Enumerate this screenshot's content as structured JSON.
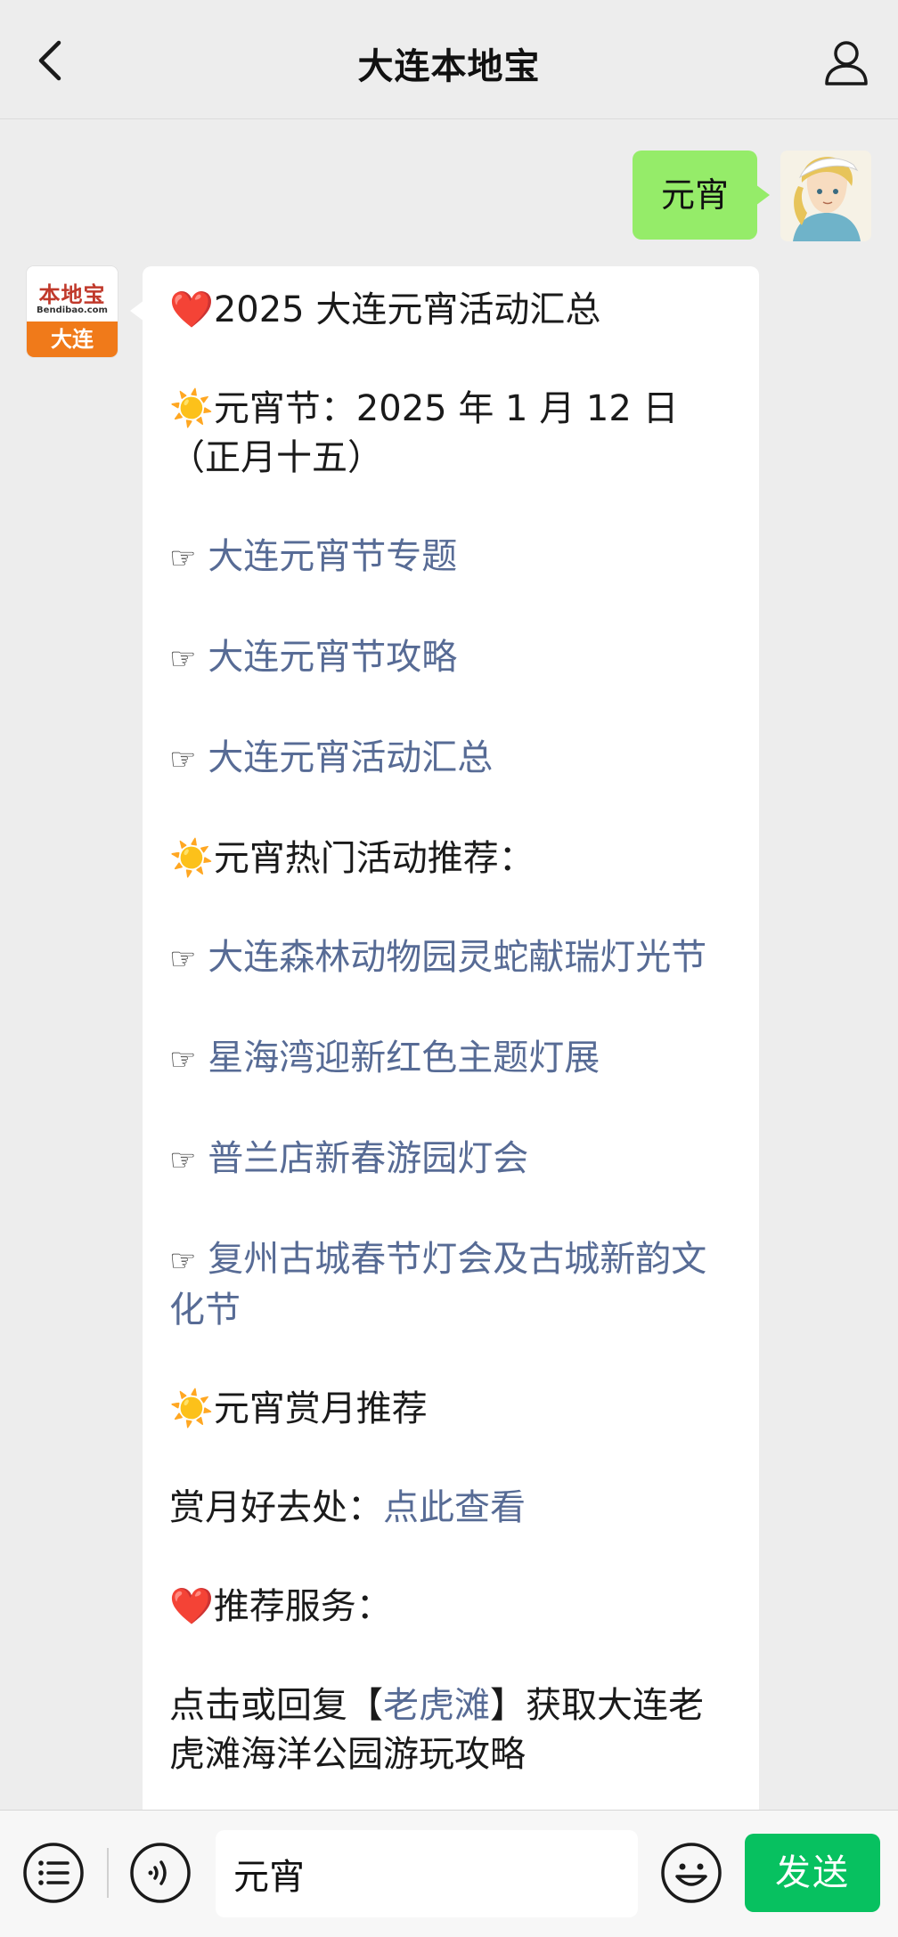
{
  "header": {
    "title": "大连本地宝"
  },
  "user_message": {
    "text": "元宵"
  },
  "bot_avatar": {
    "logo_text": "本地宝",
    "logo_sub": "Bendibao.com",
    "city": "大连"
  },
  "bot_message": {
    "heart": "❤️",
    "sun": "☀️",
    "hand": "☞",
    "line1": "2025 大连元宵活动汇总",
    "line2": "元宵节：2025 年 1 月 12 日（正月十五）",
    "link1": "大连元宵节专题",
    "link2": "大连元宵节攻略",
    "link3": "大连元宵活动汇总",
    "section2": "元宵热门活动推荐：",
    "link4": "大连森林动物园灵蛇献瑞灯光节",
    "link5": "星海湾迎新红色主题灯展",
    "link6": "普兰店新春游园灯会",
    "link7": "复州古城春节灯会及古城新韵文化节",
    "section3": "元宵赏月推荐",
    "moon_prefix": "赏月好去处：",
    "moon_link": "点此查看",
    "section4": "推荐服务：",
    "service_prefix": "点击或回复【",
    "service_link": "老虎滩",
    "service_suffix": "】获取大连老虎滩海洋公园游玩攻略"
  },
  "input_bar": {
    "input_value": "元宵",
    "send_label": "发送"
  },
  "colors": {
    "user_bubble": "#95ec69",
    "link": "#576b95",
    "send_button": "#07c160",
    "background": "#ededed"
  }
}
